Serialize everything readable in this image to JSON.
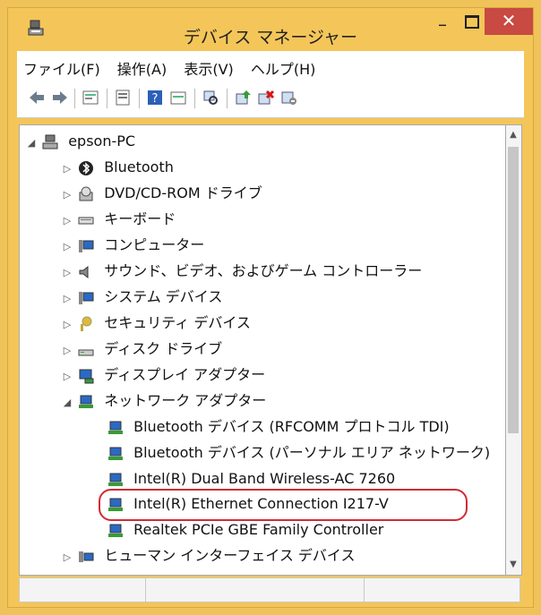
{
  "window": {
    "title": "デバイス マネージャー",
    "min_label": "–",
    "close_label": "✕"
  },
  "menu": [
    {
      "label": "ファイル(F)"
    },
    {
      "label": "操作(A)"
    },
    {
      "label": "表示(V)"
    },
    {
      "label": "ヘルプ(H)"
    }
  ],
  "toolbar": {
    "buttons": [
      "back-icon",
      "forward-icon",
      "properties-icon",
      "console-icon",
      "help-icon",
      "show-hidden-icon",
      "scan-icon",
      "update-driver-icon",
      "uninstall-icon",
      "disable-icon"
    ]
  },
  "tree": {
    "root": {
      "label": "epson-PC",
      "icon": "computer-icon"
    },
    "items": [
      {
        "label": "Bluetooth",
        "icon": "bluetooth-icon",
        "expander": "▷"
      },
      {
        "label": "DVD/CD-ROM ドライブ",
        "icon": "dvd-drive-icon",
        "expander": "▷"
      },
      {
        "label": "キーボード",
        "icon": "keyboard-icon",
        "expander": "▷"
      },
      {
        "label": "コンピューター",
        "icon": "monitor-icon",
        "expander": "▷"
      },
      {
        "label": "サウンド、ビデオ、およびゲーム コントローラー",
        "icon": "speaker-icon",
        "expander": "▷"
      },
      {
        "label": "システム デバイス",
        "icon": "system-device-icon",
        "expander": "▷"
      },
      {
        "label": "セキュリティ デバイス",
        "icon": "security-key-icon",
        "expander": "▷"
      },
      {
        "label": "ディスク ドライブ",
        "icon": "disk-drive-icon",
        "expander": "▷"
      },
      {
        "label": "ディスプレイ アダプター",
        "icon": "display-adapter-icon",
        "expander": "▷"
      },
      {
        "label": "ネットワーク アダプター",
        "icon": "network-adapter-icon",
        "expander": "◢"
      }
    ],
    "network_children": [
      {
        "label": "Bluetooth デバイス (RFCOMM プロトコル TDI)"
      },
      {
        "label": "Bluetooth デバイス (パーソナル エリア ネットワーク)"
      },
      {
        "label": "Intel(R) Dual Band Wireless-AC 7260"
      },
      {
        "label": "Intel(R) Ethernet Connection I217-V"
      },
      {
        "label": "Realtek PCIe GBE Family Controller"
      }
    ],
    "after": [
      {
        "label": "ヒューマン インターフェイス デバイス",
        "icon": "hid-icon",
        "expander": "▷"
      }
    ]
  },
  "colors": {
    "title_bar": "#f4c659",
    "close_button": "#c84a42",
    "highlight_ring": "#d12b36"
  }
}
